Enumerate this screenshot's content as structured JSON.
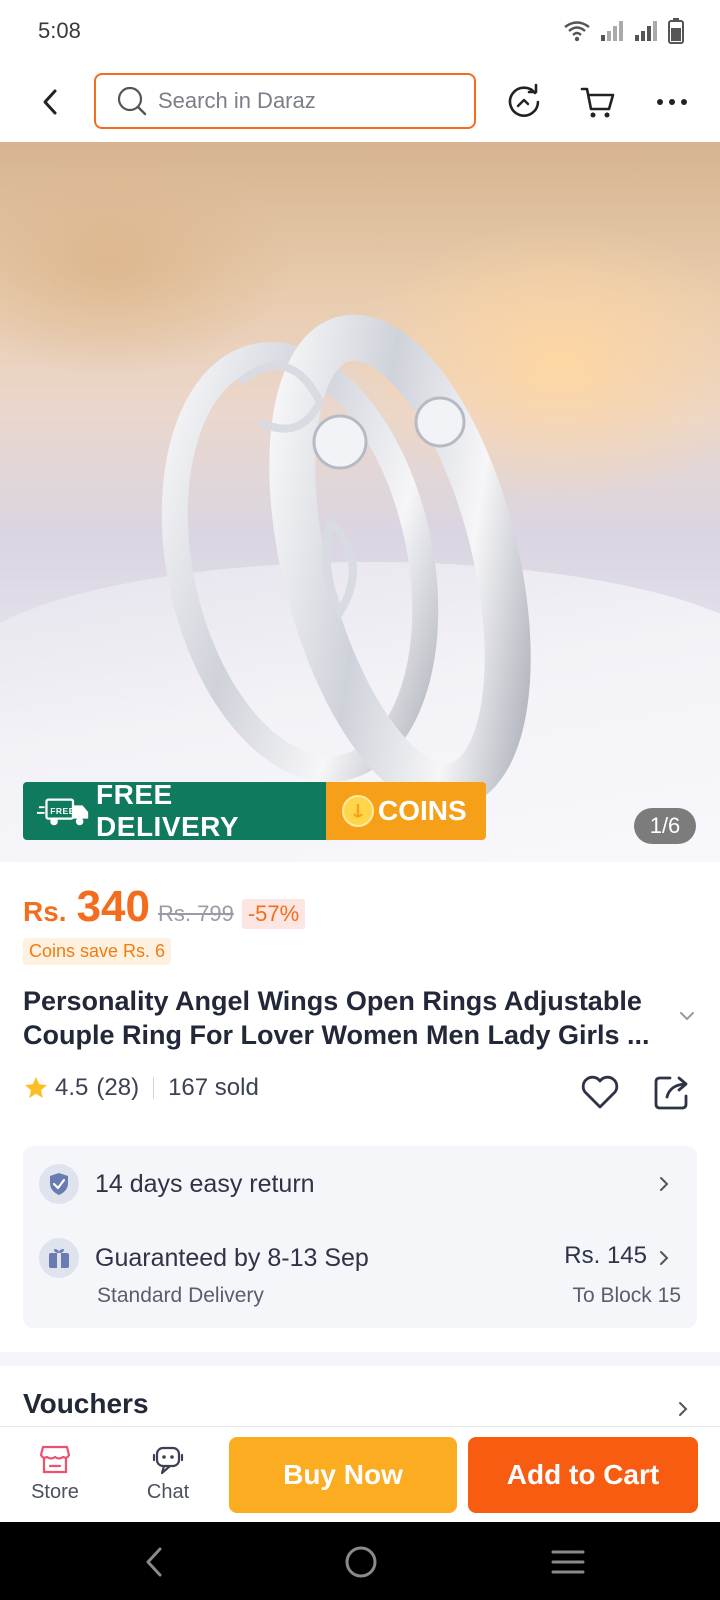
{
  "status_bar": {
    "time": "5:08"
  },
  "header": {
    "search_placeholder": "Search in Daraz"
  },
  "gallery": {
    "page_indicator": "1/6",
    "promo_free": "FREE DELIVERY",
    "promo_free_truck": "FREE",
    "promo_coins": "COINS"
  },
  "price": {
    "currency": "Rs.",
    "current": "340",
    "original": "Rs. 799",
    "discount": "-57%",
    "coins_save": "Coins save Rs. 6"
  },
  "product": {
    "title": "Personality Angel Wings Open Rings Adjustable Couple Ring For Lover Women Men Lady Girls ...",
    "rating": "4.5",
    "rating_count": "(28)",
    "sold": "167 sold"
  },
  "info": {
    "return_text": "14 days easy return",
    "delivery_text": "Guaranteed by 8-13 Sep",
    "delivery_fee": "Rs. 145",
    "delivery_type": "Standard Delivery",
    "delivery_location": "To Block 15"
  },
  "vouchers": {
    "label": "Vouchers"
  },
  "bottom_bar": {
    "store_label": "Store",
    "chat_label": "Chat",
    "buy_now": "Buy Now",
    "add_to_cart": "Add to Cart"
  },
  "colors": {
    "brand_orange": "#f36d1d",
    "buy_now": "#fcac20",
    "add_to_cart": "#f75c10",
    "free_delivery": "#0f7a5e",
    "coins": "#f6a01a"
  }
}
